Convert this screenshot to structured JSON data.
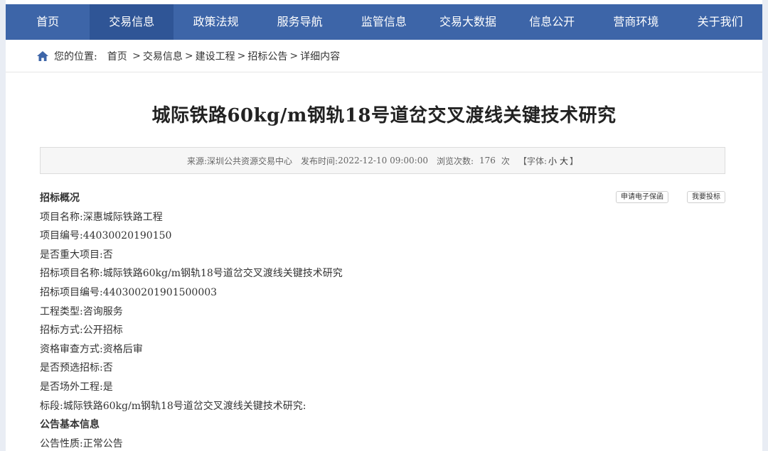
{
  "nav": {
    "items": [
      {
        "label": "首页"
      },
      {
        "label": "交易信息"
      },
      {
        "label": "政策法规"
      },
      {
        "label": "服务导航"
      },
      {
        "label": "监管信息"
      },
      {
        "label": "交易大数据"
      },
      {
        "label": "信息公开"
      },
      {
        "label": "营商环境"
      },
      {
        "label": "关于我们"
      }
    ]
  },
  "breadcrumb": {
    "prefix": "您的位置:",
    "items": [
      "首页",
      "交易信息",
      "建设工程",
      "招标公告",
      "详细内容"
    ]
  },
  "article": {
    "title": "城际铁路60kg/m钢轨18号道岔交叉渡线关键技术研究",
    "meta": {
      "source_label": "来源:",
      "source": "深圳公共资源交易中心",
      "publish_label": "发布时间:",
      "publish_time": "2022-12-10 09:00:00",
      "views_label": "浏览次数:",
      "views": "176",
      "views_unit": "次",
      "font_label": "【字体:",
      "font_small": "小",
      "font_large": "大",
      "font_close": "】"
    }
  },
  "actions": {
    "apply_guarantee": "申请电子保函",
    "submit_bid": "我要投标"
  },
  "content": {
    "rows": [
      "招标概况",
      "项目名称:深惠城际铁路工程",
      "项目编号:44030020190150",
      "是否重大项目:否",
      "招标项目名称:城际铁路60kg/m钢轨18号道岔交叉渡线关键技术研究",
      "招标项目编号:440300201901500003",
      "工程类型:咨询服务",
      "招标方式:公开招标",
      "资格审查方式:资格后审",
      "是否预选招标:否",
      "是否场外工程:是",
      "标段:城际铁路60kg/m钢轨18号道岔交叉渡线关键技术研究:",
      "公告基本信息",
      "公告性质:正常公告"
    ]
  },
  "colors": {
    "nav_bg": "#3d65a8",
    "nav_active": "#2f5596",
    "home_icon": "#3d65a8"
  }
}
